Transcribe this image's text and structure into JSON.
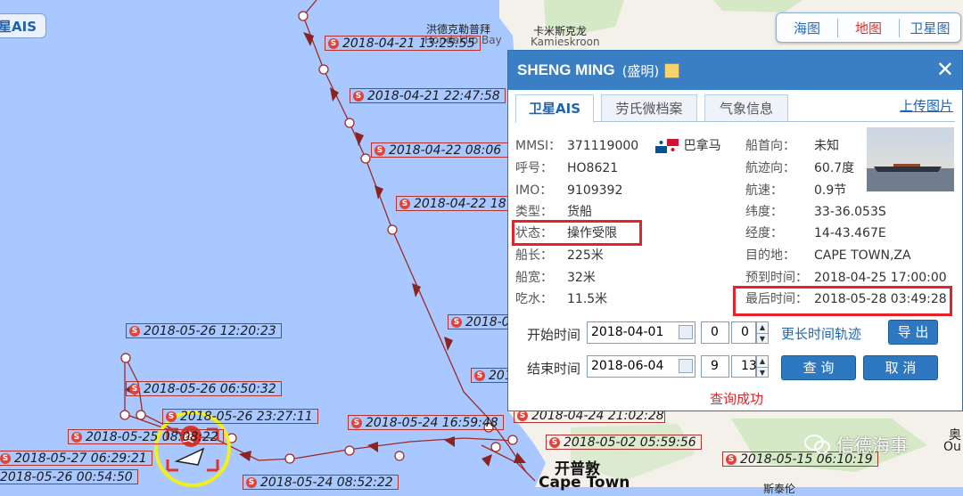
{
  "map": {
    "ais_button": "星AIS",
    "map_types": [
      {
        "label": "海图",
        "active": false
      },
      {
        "label": "地图",
        "active": true
      },
      {
        "label": "卫星图",
        "active": false
      }
    ],
    "place_labels": [
      {
        "text": "洪德克勒普拜",
        "name": "place-hondeklip-cn"
      },
      {
        "text": "Hondeklip Bay",
        "name": "place-hondeklip-en"
      },
      {
        "text": "卡米斯克龙",
        "name": "place-kamieskroon-cn"
      },
      {
        "text": "Kamieskroon",
        "name": "place-kamieskroon-en"
      },
      {
        "text": "开普敦",
        "name": "place-capetown-cn"
      },
      {
        "text": "Cape Town",
        "name": "place-capetown-en"
      },
      {
        "text": "奥",
        "name": "place-edge-cn"
      },
      {
        "text": "Ou",
        "name": "place-edge-en"
      },
      {
        "text": "斯泰伦",
        "name": "place-stellenbosch-cn"
      }
    ],
    "end_marker": "终",
    "watermark": "信德海事",
    "track_labels": [
      "2018-04-21 13:25:55",
      "2018-04-21 22:47:58",
      "2018-04-22 08:06",
      "2018-04-22 18",
      "2018-0",
      "201",
      "2018-05-26 12:20:23",
      "2018-05-26 06:50:32",
      "2018-05-26 23:27:11",
      "2018-05-25 08:08:22",
      "2018-05-24 16:59:48",
      "2018-04-24 21:02:28",
      "2018-05-02 05:59:56",
      "2018-05-15 06:10:19",
      "2018-05-27 06:29:21",
      "2018-05-26 00:54:50",
      "2018-05-24 08:52:22"
    ]
  },
  "panel": {
    "title": "SHENG MING",
    "subtitle": "(盛明)",
    "close": "✕",
    "tabs": [
      "卫星AIS",
      "劳氏微档案",
      "气象信息"
    ],
    "upload_link": "上传图片",
    "left_fields": [
      {
        "label": "MMSI：",
        "value": "371119000"
      },
      {
        "label": "呼号：",
        "value": "HO8621"
      },
      {
        "label": "IMO：",
        "value": "9109392"
      },
      {
        "label": "类型：",
        "value": "货船"
      },
      {
        "label": "状态：",
        "value": "操作受限"
      },
      {
        "label": "船长：",
        "value": "225米"
      },
      {
        "label": "船宽：",
        "value": "32米"
      },
      {
        "label": "吃水：",
        "value": "11.5米"
      }
    ],
    "flag_country": "巴拿马",
    "right_fields": [
      {
        "label": "船首向：",
        "value": "未知"
      },
      {
        "label": "航迹向：",
        "value": "60.7度"
      },
      {
        "label": "航速：",
        "value": "0.9节"
      },
      {
        "label": "纬度：",
        "value": "33-36.053S"
      },
      {
        "label": "经度：",
        "value": "14-43.467E"
      },
      {
        "label": "目的地：",
        "value": "CAPE TOWN,ZA"
      },
      {
        "label": "预到时间：",
        "value": "2018-04-25 17:00:00"
      },
      {
        "label": "最后时间：",
        "value": "2018-05-28 03:49:28"
      }
    ],
    "query": {
      "start_label": "开始时间",
      "start_date": "2018-04-01",
      "start_hour": "0",
      "start_min": "0",
      "end_label": "结束时间",
      "end_date": "2018-06-04",
      "end_hour": "9",
      "end_min": "13",
      "longer_link": "更长时间轨迹",
      "export_btn": "导 出",
      "query_btn": "查 询",
      "cancel_btn": "取 消",
      "status": "查询成功"
    }
  },
  "colors": {
    "sea": "#a8c8ff",
    "land": "#f4f1ea",
    "track": "#9e2b27",
    "panel_header": "#3a7fc4",
    "highlight": "#e5222a"
  }
}
